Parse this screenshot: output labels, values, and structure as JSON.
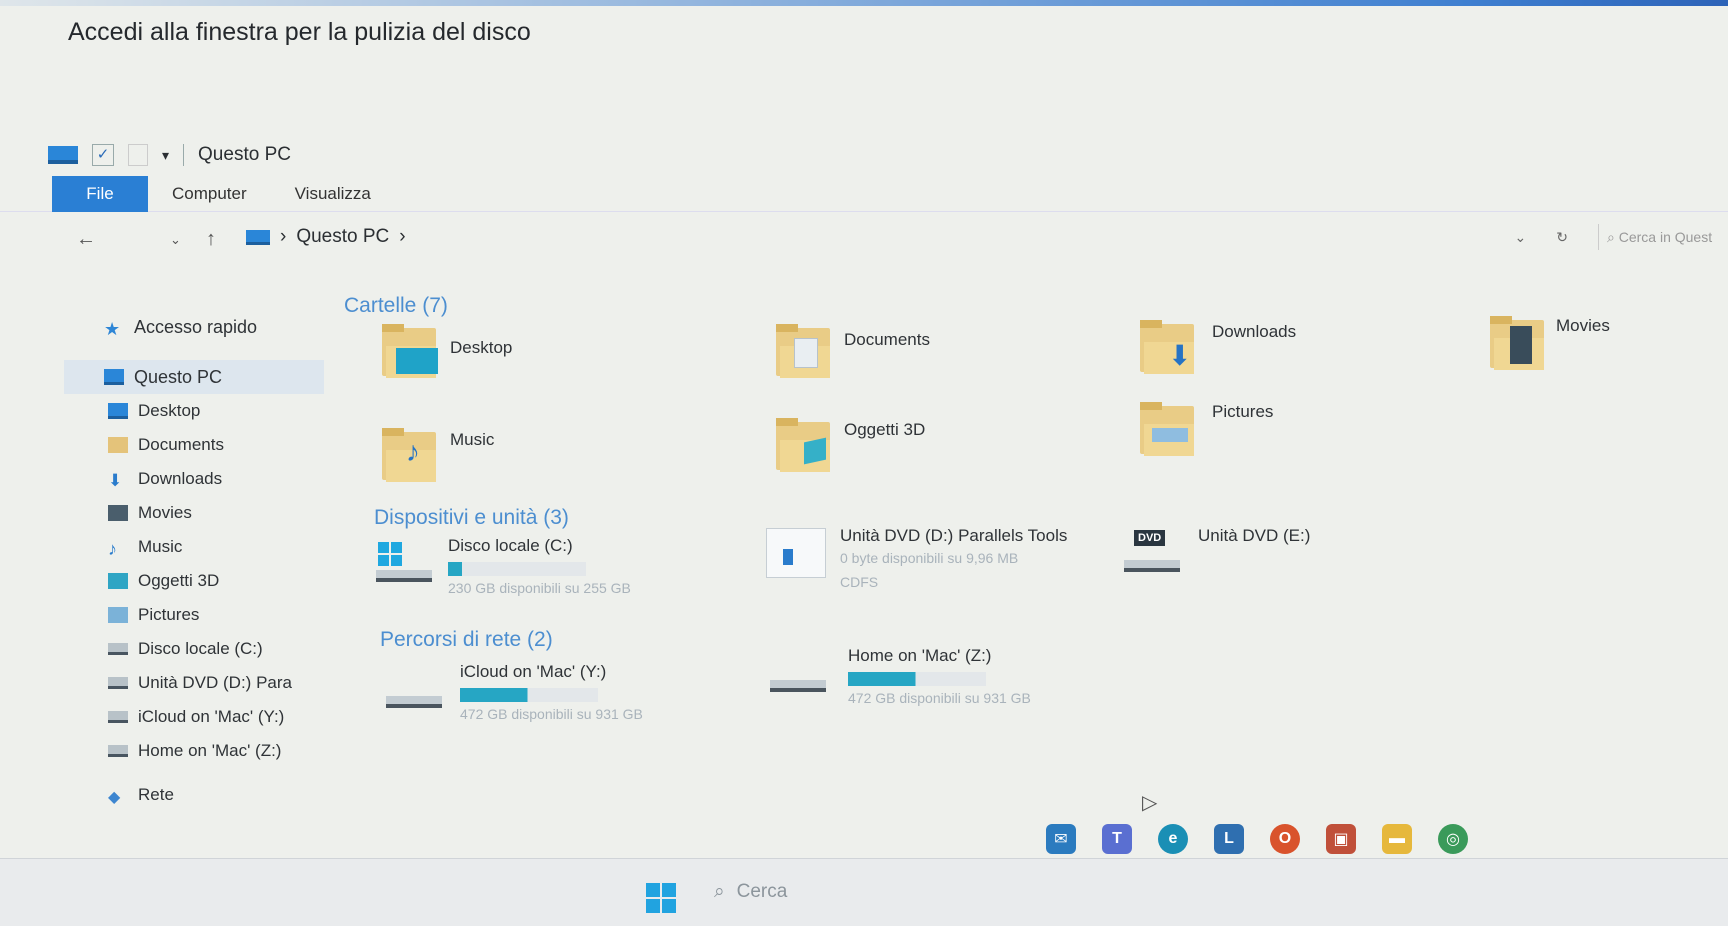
{
  "caption": "Accedi alla finestra per la pulizia del disco",
  "window": {
    "title": "Questo PC",
    "ribbon_tabs": [
      "File",
      "Computer",
      "Visualizza"
    ],
    "breadcrumb": "Questo PC",
    "search_placeholder": "Cerca in Questo PC",
    "search_visible": "Cerca in Quest"
  },
  "sidebar": {
    "quick_access": "Accesso rapido",
    "this_pc": "Questo PC",
    "items": [
      "Desktop",
      "Documents",
      "Downloads",
      "Movies",
      "Music",
      "Oggetti 3D",
      "Pictures",
      "Disco locale (C:)",
      "Unità DVD (D:) Para",
      "iCloud on 'Mac' (Y:)",
      "Home on 'Mac' (Z:)"
    ],
    "network": "Rete"
  },
  "groups": {
    "folders": "Cartelle (7)",
    "devices": "Dispositivi e unità (3)",
    "network": "Percorsi di rete (2)"
  },
  "folders": [
    "Desktop",
    "Documents",
    "Downloads",
    "Movies",
    "Music",
    "Oggetti 3D",
    "Pictures"
  ],
  "devices": [
    {
      "name": "Disco locale (C:)",
      "detail": "230 GB disponibili su 255 GB",
      "used_fraction": 0.1
    },
    {
      "name": "Unità DVD (D:) Parallels Tools",
      "detail": "0 byte disponibili su 9,96 MB",
      "fs": "CDFS"
    },
    {
      "name": "Unità DVD (E:)",
      "badge": "DVD"
    }
  ],
  "network_locations": [
    {
      "name": "iCloud on 'Mac' (Y:)",
      "detail": "472 GB disponibili su 931 GB",
      "used_fraction": 0.49
    },
    {
      "name": "Home on 'Mac' (Z:)",
      "detail": "472 GB disponibili su 931 GB",
      "used_fraction": 0.49
    }
  ],
  "taskbar": {
    "search": "Cerca",
    "tray_letter": "L"
  },
  "colors": {
    "accent": "#2a7fd4",
    "group_title": "#4c8ed0",
    "bar": "#26a6c4",
    "folder": "#e9cc86"
  }
}
